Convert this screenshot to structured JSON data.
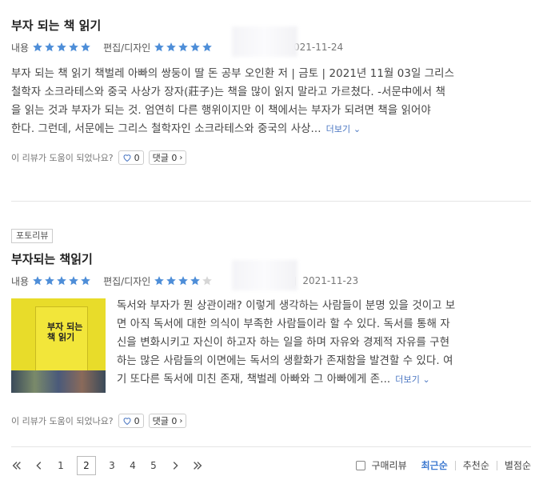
{
  "colors": {
    "star_full": "#4e8ed8",
    "star_empty": "#d6d6d6",
    "active_sort": "#3d79d0"
  },
  "reviews": [
    {
      "photo_tag": "",
      "title": "부자 되는 책 읽기",
      "rating_content_label": "내용",
      "rating_content": 5,
      "rating_design_label": "편집/디자인",
      "rating_design": 5,
      "date": "2021-11-24",
      "content_lines": [
        "부자 되는 책 읽기 책벌레 아빠의 쌍둥이 딸 돈 공부 오인환 저 | 금토 | 2021년 11월 03일 그리스",
        "철학자 소크라테스와 중국 사상가 장자(莊子)는 책을 많이 읽지 말라고 가르쳤다. -서문中에서 책",
        "을 읽는 것과 부자가 되는 것. 엄연히 다른 행위이지만 이 책에서는 부자가 되려면 책을 읽어야",
        "한다. 그런데, 서문에는 그리스 철학자인 소크라테스와 중국의 사상..."
      ],
      "more_label": "더보기",
      "helpful_label": "이 리뷰가 도움이 되었나요?",
      "like_count": "0",
      "comment_label": "댓글 0"
    },
    {
      "photo_tag": "포토리뷰",
      "title": "부자되는 책읽기",
      "rating_content_label": "내용",
      "rating_content": 5,
      "rating_design_label": "편집/디자인",
      "rating_design": 4,
      "date": "2021-11-23",
      "thumb_text": "부자 되는 책 읽기",
      "content_lines": [
        "독서와 부자가 뭔 상관이래? 이렇게 생각하는 사람들이 분명 있을 것이고 보",
        "면 아직 독서에 대한 의식이 부족한 사람들이라 할 수 있다. 독서를 통해 자",
        "신을 변화시키고 자신이 하고자 하는 일을 하며 자유와 경제적 자유를 구현",
        "하는 많은 사람들의 이면에는 독서의 생활화가 존재함을 발견할 수 있다. 여",
        "기 또다른 독서에 미친 존재, 책벌레 아빠와 그 아빠에게 존..."
      ],
      "more_label": "더보기",
      "helpful_label": "이 리뷰가 도움이 되었나요?",
      "like_count": "0",
      "comment_label": "댓글 0"
    }
  ],
  "pagination": {
    "pages": [
      "1",
      "2",
      "3",
      "4",
      "5"
    ],
    "current": "2"
  },
  "sort": {
    "purchase_review_label": "구매리뷰",
    "options": [
      "최근순",
      "추천순",
      "별점순"
    ],
    "active": "최근순"
  }
}
